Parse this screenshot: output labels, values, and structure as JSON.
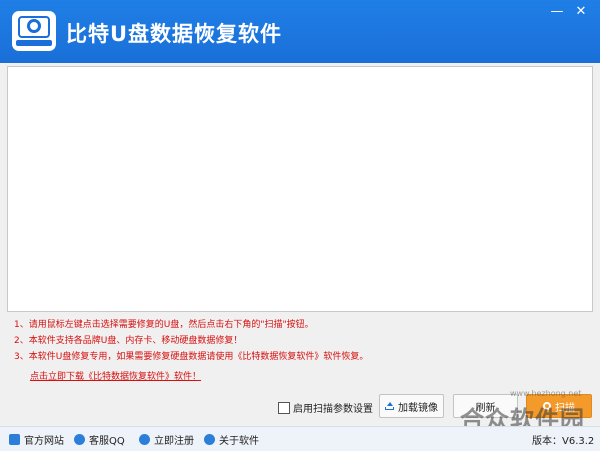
{
  "window": {
    "title": "比特U盘数据恢复软件",
    "minimize_glyph": "—",
    "close_glyph": "✕"
  },
  "notes": [
    "1、请用鼠标左键点击选择需要修复的U盘，然后点击右下角的\"扫描\"按钮。",
    "2、本软件支持各品牌U盘、内存卡、移动硬盘数据修复！",
    "3、本软件U盘修复专用，如果需要修复硬盘数据请使用《比特数据恢复软件》软件恢复。"
  ],
  "download_link": "点击立即下载《比特数据恢复软件》软件！",
  "actions": {
    "scan_params_label": "启用扫描参数设置",
    "load_image_label": "加载镜像",
    "refresh_label": "刷新",
    "scan_label": "扫描"
  },
  "statusbar": {
    "official_site": "官方网站",
    "support_qq": "客服QQ",
    "register": "立即注册",
    "about": "关于软件",
    "version": "版本：V6.3.2"
  },
  "watermark": {
    "brand": "合众软件园",
    "url": "www.hezhong.net"
  },
  "colors": {
    "titlebar": "#1a6fd8",
    "note_text": "#d80f0f",
    "scan_button": "#f39a2b"
  },
  "icons": {
    "app_logo": "disk-icon",
    "load_image": "upload-icon",
    "scan": "search-icon",
    "official_site": "home-icon",
    "support_qq": "qq-icon",
    "register": "register-icon",
    "about": "info-icon"
  }
}
